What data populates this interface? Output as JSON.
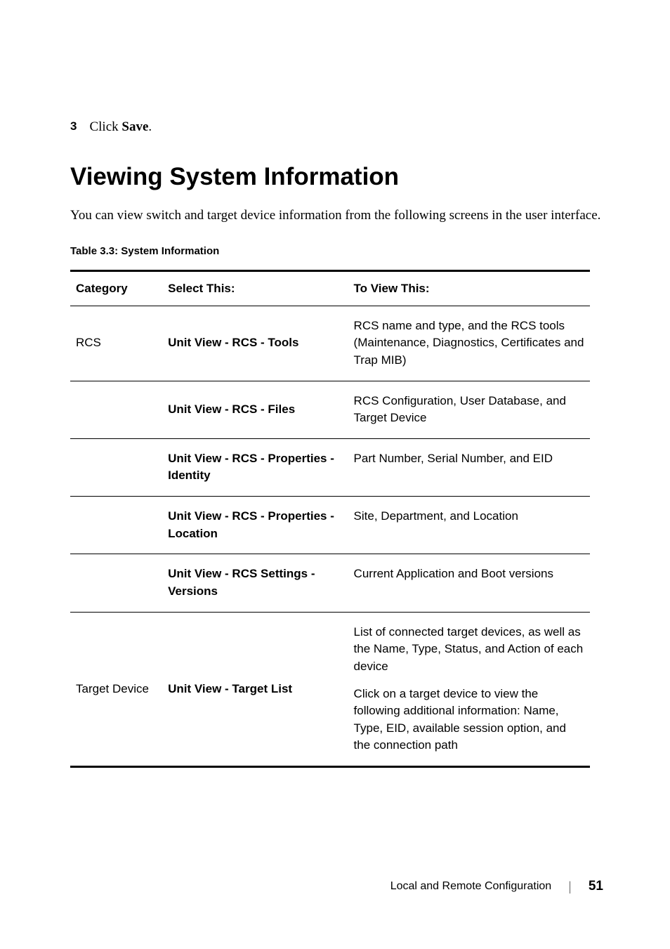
{
  "step": {
    "number": "3",
    "prefix": "Click ",
    "bold": "Save",
    "suffix": "."
  },
  "heading": "Viewing System Information",
  "intro": "You can view switch and target device information from the following screens in the user interface.",
  "table_caption": "Table 3.3: System Information",
  "headers": {
    "category": "Category",
    "select": "Select This:",
    "view": "To View This:"
  },
  "rows": [
    {
      "category": "RCS",
      "select": "Unit View - RCS - Tools",
      "view": [
        "RCS name and type, and the RCS tools (Maintenance, Diagnostics, Certificates and Trap MIB)"
      ]
    },
    {
      "category": "",
      "select": "Unit View - RCS - Files",
      "view": [
        "RCS Configuration, User Database, and Target Device"
      ]
    },
    {
      "category": "",
      "select": "Unit View - RCS - Properties - Identity",
      "view": [
        "Part Number, Serial Number, and EID"
      ]
    },
    {
      "category": "",
      "select": "Unit View - RCS - Properties - Location",
      "view": [
        "Site, Department, and Location"
      ]
    },
    {
      "category": "",
      "select": "Unit View - RCS Settings - Versions",
      "view": [
        "Current Application and Boot versions"
      ]
    },
    {
      "category": "Target Device",
      "select": "Unit View - Target List",
      "view": [
        "List of connected target devices, as well as the Name, Type, Status, and Action of each device",
        "Click on a target device to view the following additional information: Name, Type, EID, available session option, and the connection path"
      ]
    }
  ],
  "footer": {
    "section": "Local and Remote Configuration",
    "page": "51"
  }
}
